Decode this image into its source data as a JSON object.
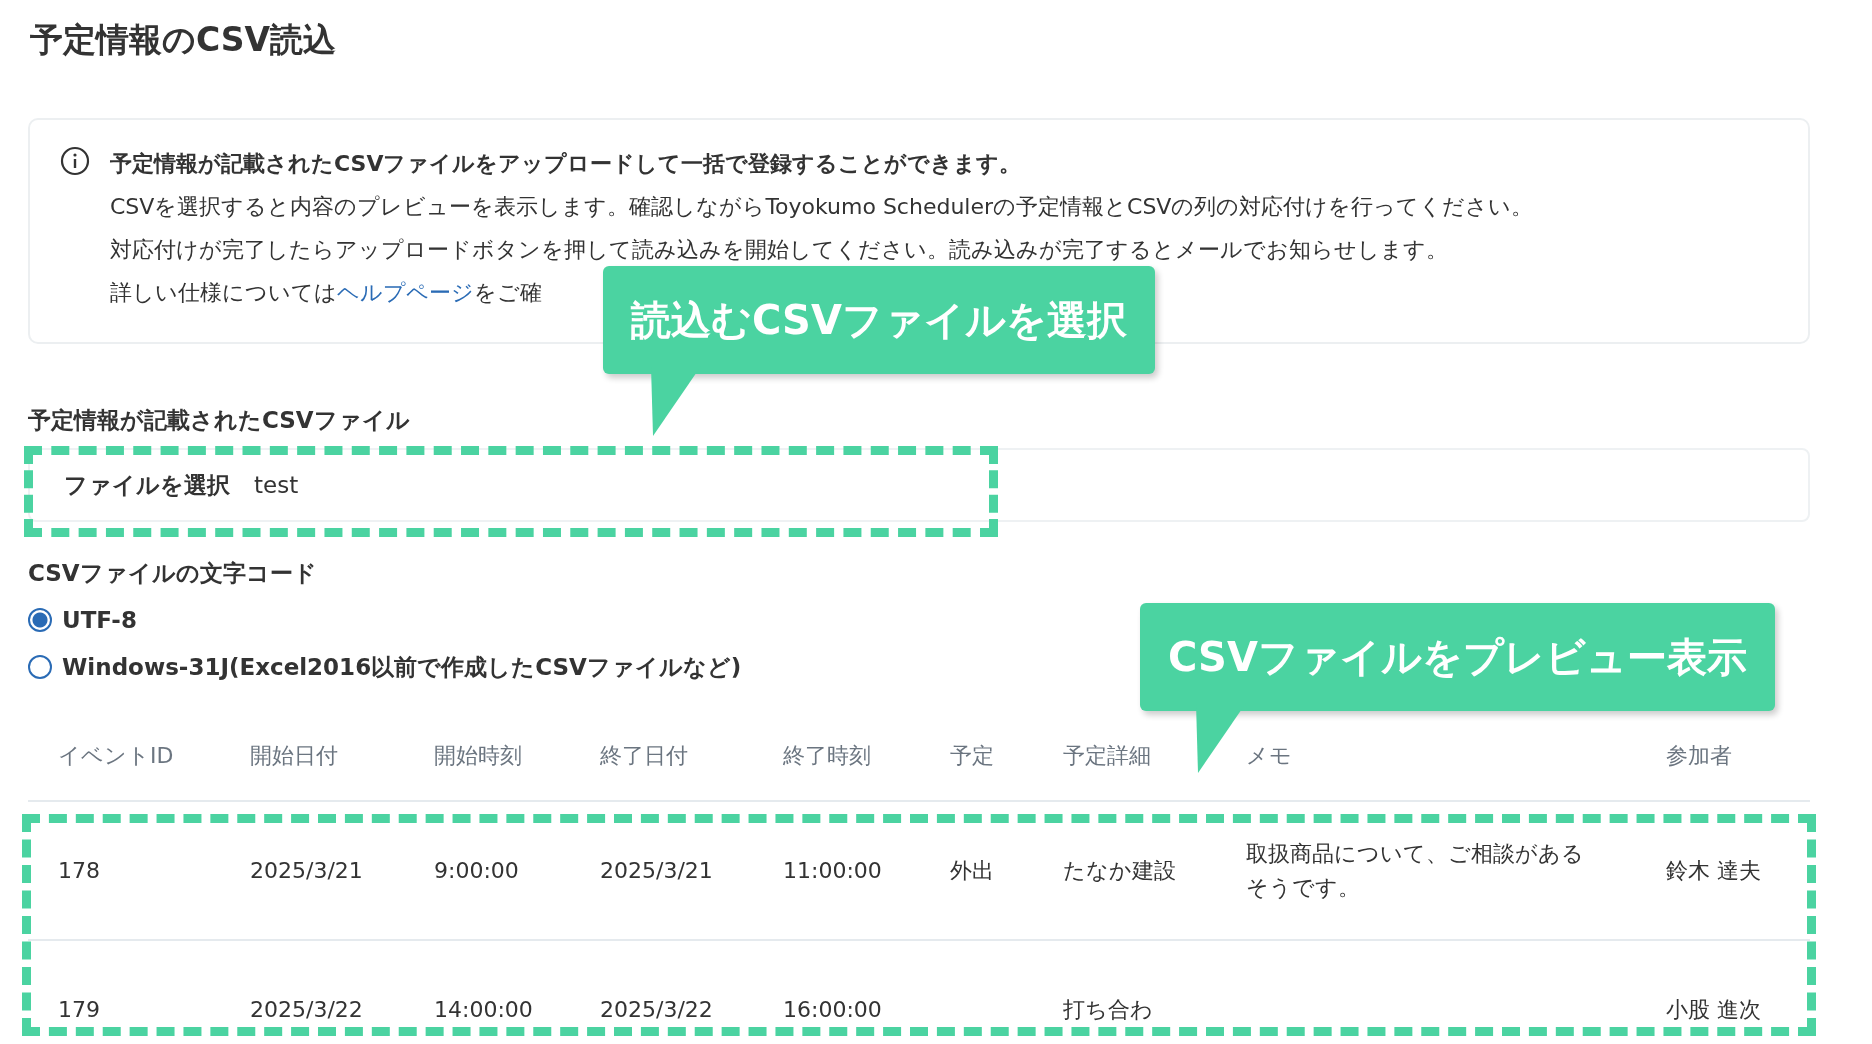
{
  "title": "予定情報のCSV読込",
  "info": {
    "lines": [
      {
        "kind": "bold",
        "text": "予定情報が記載されたCSVファイルをアップロードして一括で登録することができます。"
      },
      {
        "kind": "plain",
        "text": "CSVを選択すると内容のプレビューを表示します。確認しながらToyokumo Schedulerの予定情報とCSVの列の対応付けを行ってください。"
      },
      {
        "kind": "plain",
        "text": "対応付けが完了したらアップロードボタンを押して読み込みを開始してください。読み込みが完了するとメールでお知らせします。"
      },
      {
        "kind": "link",
        "before": "詳しい仕様については",
        "link": "ヘルプページ",
        "after": "をご確"
      }
    ]
  },
  "file": {
    "label": "予定情報が記載されたCSVファイル",
    "button": "ファイルを選択",
    "value": "test"
  },
  "encoding": {
    "label": "CSVファイルの文字コード",
    "options": [
      {
        "label": "UTF-8",
        "selected": true
      },
      {
        "label": "Windows-31J(Excel2016以前で作成したCSVファイルなど)",
        "selected": false
      }
    ]
  },
  "table": {
    "columns": [
      "イベントID",
      "開始日付",
      "開始時刻",
      "終了日付",
      "終了時刻",
      "予定",
      "予定詳細",
      "メモ",
      "参加者"
    ],
    "rows": [
      [
        "178",
        "2025/3/21",
        "9:00:00",
        "2025/3/21",
        "11:00:00",
        "外出",
        "たなか建設",
        "取扱商品について、ご相談があるそうです。",
        "鈴木 達夫"
      ],
      [
        "179",
        "2025/3/22",
        "14:00:00",
        "2025/3/22",
        "16:00:00",
        "",
        "打ち合わ",
        "",
        "小股 進次"
      ]
    ]
  },
  "annotations": [
    {
      "text": "読込むCSVファイルを選択"
    },
    {
      "text": "CSVファイルをプレビュー表示"
    }
  ]
}
